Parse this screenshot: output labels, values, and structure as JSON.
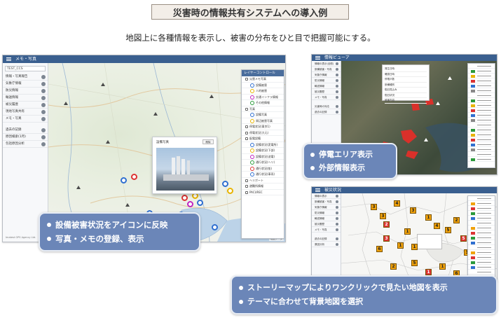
{
  "title": "災害時の情報共有システムへの導入例",
  "subtitle": "地図上に各種情報を表示し、被害の分布をひと目で把握可能にする。",
  "left_window": {
    "header": "メモ・写真",
    "search_value": "TEST_CCS",
    "sidebar_items": [
      "情報・写真報告",
      "気象庁情報",
      "防災情報",
      "輸送情報",
      "被災履歴",
      "現地写真共有",
      "メモ・写真"
    ],
    "sidebar_extra": [
      "過去の記録",
      "原因検索(1月)",
      "包括原因分析"
    ],
    "footer_text": "Imatest GPS Agency Ltd.",
    "layer_panel_title": "レイヤーコントロール",
    "layer_items": [
      "災害メモ写真",
      "設備被害",
      "人的被害",
      "交通インフラ情報",
      "その他情報",
      "写真",
      "設備写真",
      "周辺被害写真",
      "停電状況(東京1)",
      "停電状況(大元)",
      "配電設備",
      "設備状況(変電所)",
      "設備状況(下部)",
      "設備状況(送電)",
      "通行状況(ヘリ)",
      "通行状況(船)",
      "通行状況(車両)",
      "ヘリポート",
      "避難所情報",
      "PACUREC"
    ],
    "popup_title": "設備写真",
    "popup_button": "削除",
    "map_attribution": "地図データ"
  },
  "right_top_window": {
    "header": "情報ビューア",
    "sidebar_items": [
      "情報の表示(全般)",
      "設備被害・写真",
      "気象庁情報",
      "防災情報",
      "輸送情報",
      "被災履歴",
      "メモ・写真"
    ],
    "sidebar_extra": [
      "災害時の対応",
      "過去の記録"
    ],
    "info_rows": [
      "発生日時",
      "確認日時",
      "停電戸数",
      "設備種別",
      "復旧見込み",
      "復旧状況",
      "被害内容"
    ]
  },
  "right_bottom_window": {
    "header": "被災状況",
    "sidebar_items": [
      "情報の表示",
      "設備被害・写真",
      "気象庁情報",
      "防災情報",
      "輸送情報",
      "被災履歴",
      "メモ・写真"
    ],
    "sidebar_extra": [
      "過去の記録",
      "原因分析"
    ],
    "badges": [
      "3",
      "3",
      "2",
      "4",
      "3",
      "1",
      "4",
      "1",
      "3",
      "6",
      "1",
      "1",
      "5",
      "2",
      "5",
      "4",
      "3",
      "3",
      "3",
      "1",
      "1",
      "5",
      "2",
      "6",
      "3"
    ]
  },
  "callouts": {
    "left": [
      "設備被害状況をアイコンに反映",
      "写真・メモの登録、表示"
    ],
    "right_top": [
      "停電エリア表示",
      "外部情報表示"
    ],
    "right_bottom": [
      "ストーリーマップによりワンクリックで見たい地図を表示",
      "テーマに合わせて背景地図を選択"
    ]
  },
  "colors": {
    "callout_bg": "#6b86b8",
    "header_bg": "#3a5f8f",
    "title_bg": "#f3eee8",
    "outage_red": "#d9302a",
    "badge_orange": "#f0a20c"
  }
}
